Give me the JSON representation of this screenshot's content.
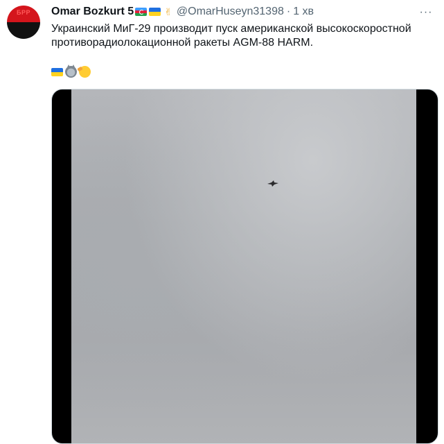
{
  "author": {
    "name": "Omar Bozkurt 5",
    "handle": "@OmarHuseyn31398",
    "separator": "·",
    "time": "1 хв",
    "avatar_text": "БРР"
  },
  "tweet": {
    "text": "Украинский МиГ-29 производит пуск американской высокоскоростной противорадиолокационной ракеты AGM-88 HARM."
  },
  "name_emojis": [
    "azerbaijan-flag-icon",
    "ukraine-flag-icon",
    "rock-hand-icon"
  ],
  "text_emojis": [
    "ukraine-flag-icon",
    "wolf-icon",
    "saluting-face-icon"
  ],
  "colors": {
    "text": "#0f1419",
    "secondary": "#536471",
    "border": "#cfd9de",
    "avatar_top": "#d4151c",
    "avatar_bottom": "#111111"
  },
  "icons": {
    "more": "more-options-icon"
  }
}
